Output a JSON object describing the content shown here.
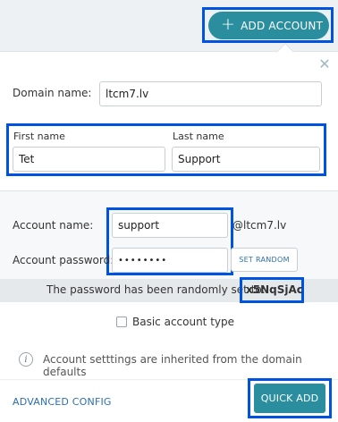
{
  "header": {
    "add_account_label": "ADD ACCOUNT"
  },
  "form": {
    "domain_label": "Domain name:",
    "domain_value": "ltcm7.lv",
    "first_name_label": "First name",
    "first_name_value": "Tet",
    "last_name_label": "Last name",
    "last_name_value": "Support",
    "account_name_label": "Account name:",
    "account_name_value": "support",
    "account_domain_suffix": "@ltcm7.lv",
    "account_password_label": "Account password:",
    "account_password_value": "••••••••",
    "set_random_label": "SET RANDOM",
    "password_notice": "The password has been randomly set to:",
    "random_password": "x5NqSjAc",
    "basic_account_label": "Basic account type",
    "info_text": "Account setttings are inherited from the domain defaults"
  },
  "footer": {
    "advanced_config_label": "ADVANCED CONFIG",
    "quick_add_label": "QUICK ADD"
  },
  "colors": {
    "accent": "#2a8e9e",
    "highlight": "#0052e0",
    "link": "#2a6fb0"
  }
}
